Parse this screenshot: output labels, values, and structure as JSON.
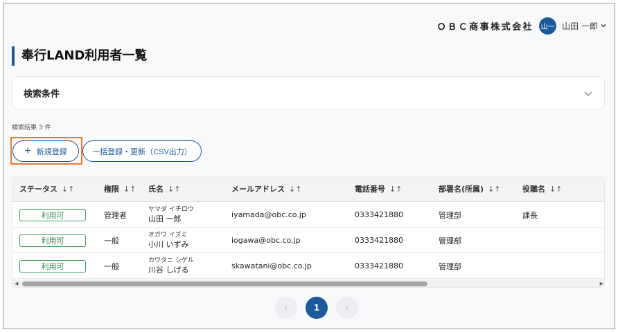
{
  "header": {
    "company": "ＯＢＣ商事株式会社",
    "avatar": "山一",
    "user_name": "山田 一郎"
  },
  "page": {
    "title": "奉行LAND利用者一覧"
  },
  "search": {
    "label": "検索条件"
  },
  "results": {
    "count_text": "検索結果 3 件"
  },
  "actions": {
    "new_label": "新規登録",
    "bulk_label": "一括登録・更新（CSV出力）"
  },
  "table": {
    "columns": [
      "ステータス",
      "権限",
      "氏名",
      "メールアドレス",
      "電話番号",
      "部署名(所属)",
      "役職名"
    ],
    "sort_icon": "↓↑",
    "rows": [
      {
        "status": "利用可",
        "role": "管理者",
        "kana": "ヤマダ イチロウ",
        "name": "山田 一郎",
        "email": "iyamada@obc.co.jp",
        "phone": "0333421880",
        "dept": "管理部",
        "title": "課長"
      },
      {
        "status": "利用可",
        "role": "一般",
        "kana": "オガワ イズミ",
        "name": "小川 いずみ",
        "email": "iogawa@obc.co.jp",
        "phone": "0333421880",
        "dept": "管理部",
        "title": ""
      },
      {
        "status": "利用可",
        "role": "一般",
        "kana": "カワタニ シゲル",
        "name": "川谷 しげる",
        "email": "skawatani@obc.co.jp",
        "phone": "0333421880",
        "dept": "管理部",
        "title": ""
      }
    ]
  },
  "pagination": {
    "current": "1",
    "prev": "‹",
    "next": "›"
  },
  "colors": {
    "accent": "#1c5a9c",
    "status_green": "#2d8a4e",
    "highlight": "#ea7a2a"
  }
}
